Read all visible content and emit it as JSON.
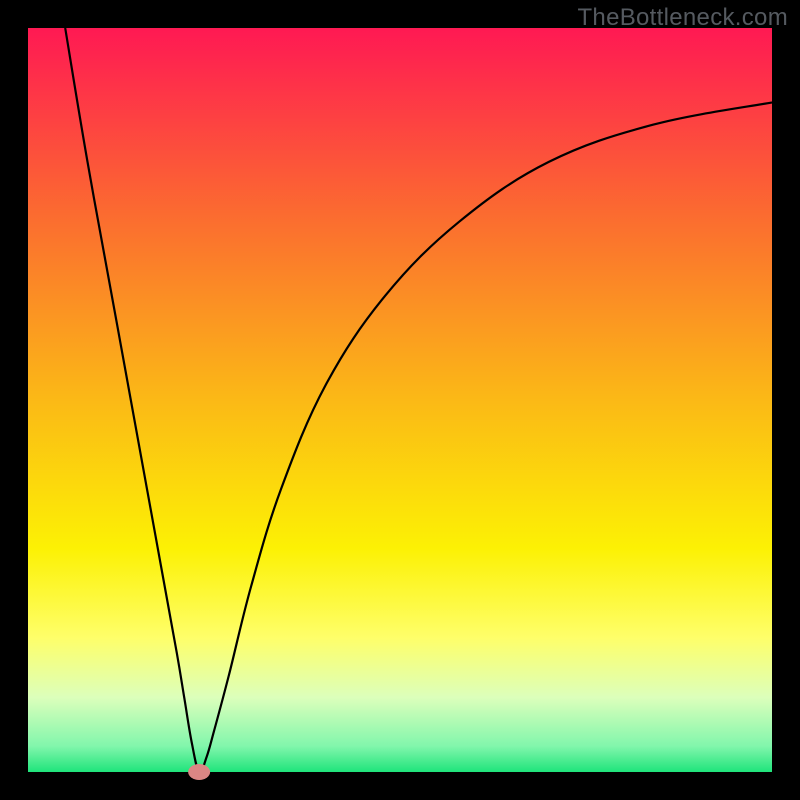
{
  "watermark": "TheBottleneck.com",
  "chart_data": {
    "type": "line",
    "title": "",
    "xlabel": "",
    "ylabel": "",
    "xlim": [
      0,
      100
    ],
    "ylim": [
      0,
      100
    ],
    "grid": false,
    "legend": false,
    "series": [
      {
        "name": "bottleneck-curve",
        "x": [
          5,
          8,
          12,
          16,
          18,
          20,
          21,
          22,
          23,
          24,
          25,
          27,
          30,
          34,
          40,
          48,
          58,
          70,
          84,
          100
        ],
        "values": [
          100,
          82,
          60,
          38,
          27,
          16,
          10,
          4,
          0,
          2,
          5.5,
          13,
          25,
          38,
          52,
          64,
          74,
          82,
          87,
          90
        ]
      }
    ],
    "markers": [
      {
        "name": "current-point",
        "x": 23,
        "y": 0
      }
    ],
    "background": {
      "type": "vertical-gradient",
      "stops": [
        {
          "offset": 0.0,
          "color": "#ff1953"
        },
        {
          "offset": 0.25,
          "color": "#fb6b30"
        },
        {
          "offset": 0.5,
          "color": "#fbb916"
        },
        {
          "offset": 0.7,
          "color": "#fcf104"
        },
        {
          "offset": 0.82,
          "color": "#feff6a"
        },
        {
          "offset": 0.9,
          "color": "#dcffbb"
        },
        {
          "offset": 0.965,
          "color": "#82f6ac"
        },
        {
          "offset": 1.0,
          "color": "#1fe47b"
        }
      ]
    }
  }
}
